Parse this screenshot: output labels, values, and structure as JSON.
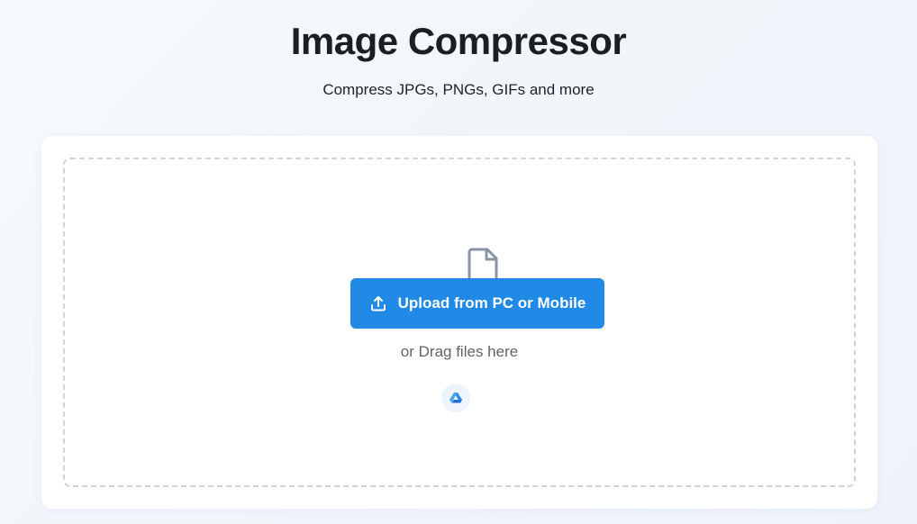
{
  "header": {
    "title": "Image Compressor",
    "subtitle": "Compress JPGs, PNGs, GIFs and more"
  },
  "dropzone": {
    "file_icon": "file-icon",
    "upload_button_label": "Upload from PC or Mobile",
    "upload_icon": "upload-icon",
    "drag_text": "or Drag files here",
    "drive_icon": "google-drive-icon"
  },
  "colors": {
    "accent": "#2189e6",
    "title": "#1b1f24",
    "muted_text": "#5f6368",
    "dashed_border": "#cfd3d8",
    "icon_gray": "#8a94a6"
  }
}
